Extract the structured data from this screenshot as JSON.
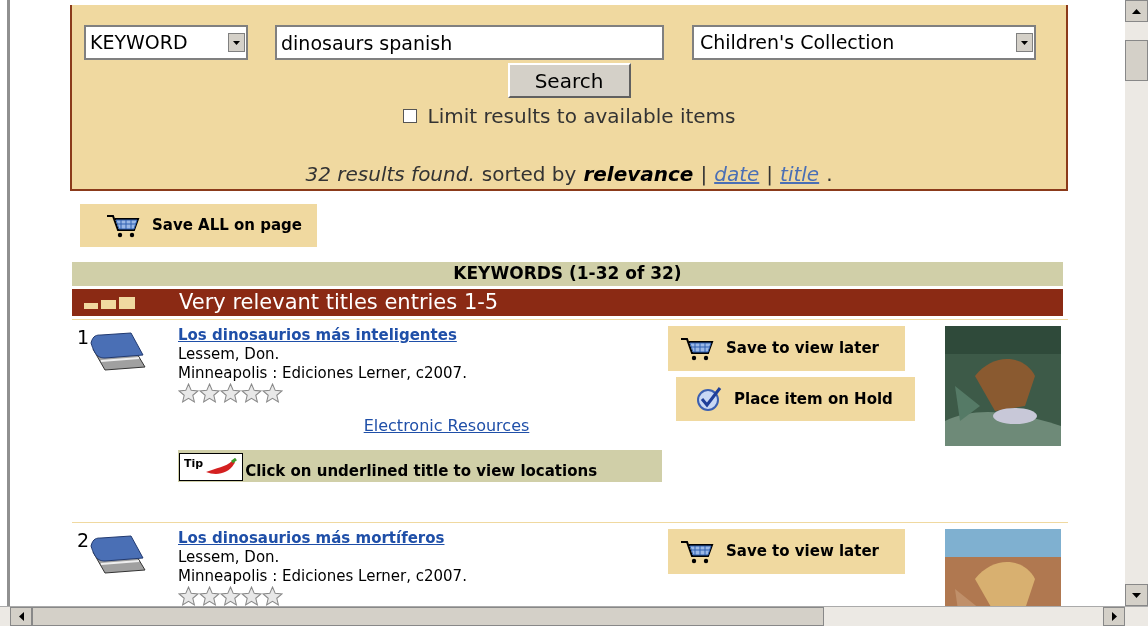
{
  "search": {
    "field_type": "KEYWORD",
    "query": "dinosaurs spanish",
    "collection": "Children's Collection",
    "button": "Search",
    "limit_available": {
      "label": "Limit results to available items",
      "checked": false
    }
  },
  "summary": {
    "count": "32 results found.",
    "sorted_by": "sorted by",
    "current_sort": "relevance",
    "sep1": "|",
    "sort_links": [
      "date",
      "title"
    ],
    "sep2": "|",
    "end": "."
  },
  "save_all": "Save ALL on page",
  "keywords_header": "KEYWORDS (1-32 of 32)",
  "relevance_header": "Very relevant titles entries 1-5",
  "results": [
    {
      "number": "1",
      "title": "Los dinosaurios más inteligentes",
      "author": "Lessem, Don.",
      "publisher": "Minneapolis : Ediciones Lerner, c2007.",
      "stars": 0,
      "link": "Electronic Resources",
      "tip_label": "Tip",
      "tip": "Click on underlined title to view locations",
      "save": "Save to view later",
      "hold": "Place item on Hold"
    },
    {
      "number": "2",
      "title": "Los dinosaurios más mortíferos",
      "author": "Lessem, Don.",
      "publisher": "Minneapolis : Ediciones Lerner, c2007.",
      "stars": 0,
      "save": "Save to view later"
    }
  ]
}
